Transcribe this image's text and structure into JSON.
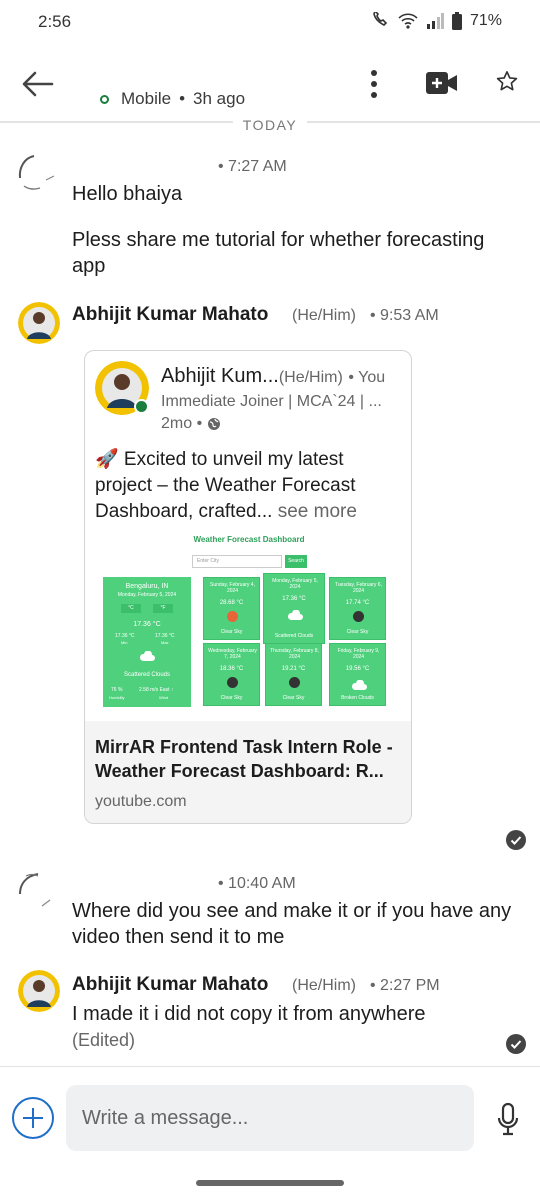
{
  "status_bar": {
    "time": "2:56",
    "battery": "71%"
  },
  "header": {
    "presence_status": "Mobile",
    "separator": "•",
    "last_seen": "3h ago",
    "icons": [
      "back-arrow-icon",
      "more-vert-icon",
      "video-call-icon",
      "star-icon"
    ]
  },
  "date_divider": "TODAY",
  "messages": [
    {
      "meta": "• 7:27 AM",
      "lines": [
        "Hello bhaiya",
        "Pless share me tutorial for whether forecasting app"
      ]
    },
    {
      "sender": "Abhijit Kumar Mahato",
      "pronouns": "(He/Him)",
      "meta": "• 9:53 AM"
    },
    {
      "meta": "• 10:40 AM",
      "text": "Where did you see and make it or if you have any video then send it to me"
    },
    {
      "sender": "Abhijit Kumar Mahato",
      "pronouns": "(He/Him)",
      "meta": "• 2:27 PM",
      "text": "I made it i did not copy it from anywhere",
      "edited": "(Edited)"
    }
  ],
  "shared_post": {
    "author": "Abhijit Kum...",
    "pronouns": "(He/Him)",
    "relation": "• You",
    "headline": "Immediate Joiner | MCA`24 | ...",
    "age": "2mo •",
    "text": "🚀 Excited to unveil my latest project – the Weather Forecast Dashboard, crafted...",
    "see_more": "see more",
    "preview": {
      "title": "Weather Forecast Dashboard",
      "search_placeholder": "Enter City",
      "search_button": "Search",
      "main": {
        "location": "Bengaluru, IN",
        "date": "Monday, February 5, 2024",
        "unit_c": "°C",
        "unit_f": "°F",
        "temp": "17.36 °C",
        "min": "17.36 °C",
        "max": "17.36 °C",
        "min_label": "Min",
        "max_label": "Max",
        "condition": "Scattered Clouds",
        "humidity": "76 %",
        "humidity_label": "Humidity",
        "wind": "2.58 m/s East ↑",
        "wind_label": "Wind"
      },
      "tiles": [
        {
          "date": "Sunday, February 4, 2024",
          "temp": "28.68 °C",
          "condition": "Clear Sky"
        },
        {
          "date": "Monday, February 5, 2024",
          "temp": "17.36 °C",
          "condition": "Scattered Clouds"
        },
        {
          "date": "Tuesday, February 6, 2024",
          "temp": "17.74 °C",
          "condition": "Clear Sky"
        },
        {
          "date": "Wednesday, February 7, 2024",
          "temp": "18.36 °C",
          "condition": "Clear Sky"
        },
        {
          "date": "Thursday, February 8, 2024",
          "temp": "19.21 °C",
          "condition": "Clear Sky"
        },
        {
          "date": "Friday, February 9, 2024",
          "temp": "19.56 °C",
          "condition": "Broken Clouds"
        }
      ]
    },
    "link_title": "MirrAR Frontend Task Intern Role - Weather Forecast Dashboard: R...",
    "link_domain": "youtube.com"
  },
  "composer": {
    "placeholder": "Write a message..."
  },
  "colors": {
    "accent_blue": "#1f6fc9",
    "online_green": "#1a7f3c",
    "weather_green": "#4fd07d"
  }
}
